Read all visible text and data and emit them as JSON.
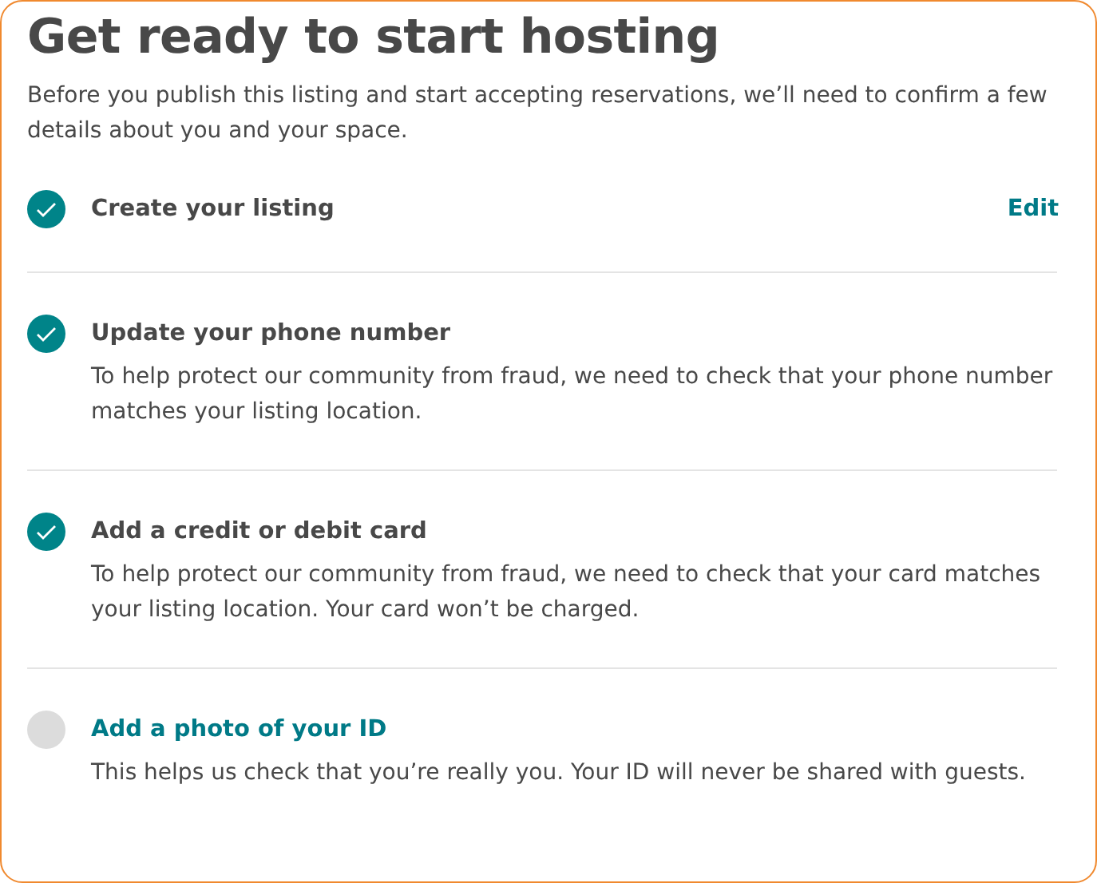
{
  "title": "Get ready to start hosting",
  "intro": "Before you publish this listing and start accepting reservations, we’ll need to confirm a few details about you and your space.",
  "steps": [
    {
      "title": "Create your listing",
      "done": true,
      "action": "Edit"
    },
    {
      "title": "Update your phone number",
      "done": true,
      "description": "To help protect our community from fraud, we need to check that your phone number matches your listing location."
    },
    {
      "title": "Add a credit or debit card",
      "done": true,
      "description": "To help protect our community from fraud, we need to check that your card matches your listing location. Your card won’t be charged."
    },
    {
      "title": "Add a photo of your ID",
      "done": false,
      "description": "This helps us check that you’re really you. Your ID will never be shared with guests."
    }
  ]
}
